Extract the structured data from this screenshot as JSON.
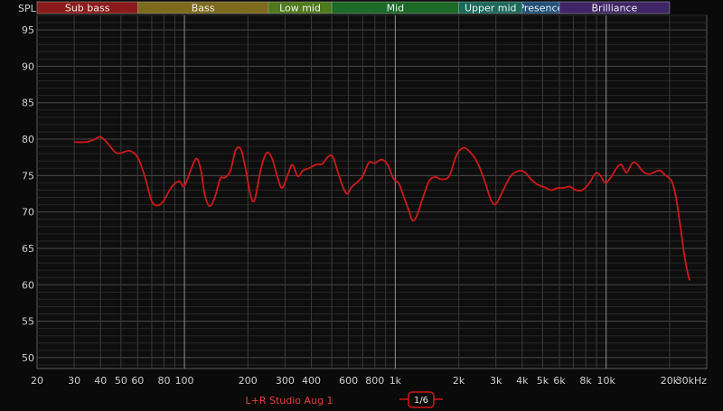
{
  "chart_data": {
    "type": "line",
    "ylabel": "SPL",
    "ylim": [
      48.5,
      97
    ],
    "xlim": [
      20,
      30000
    ],
    "x_scale": "log",
    "grid": true,
    "y_ticks": [
      95,
      90,
      85,
      80,
      75,
      70,
      65,
      60,
      55,
      50
    ],
    "x_ticks": [
      {
        "v": 20,
        "label": "20"
      },
      {
        "v": 30,
        "label": "30"
      },
      {
        "v": 40,
        "label": "40"
      },
      {
        "v": 50,
        "label": "50"
      },
      {
        "v": 60,
        "label": "60"
      },
      {
        "v": 80,
        "label": "80"
      },
      {
        "v": 100,
        "label": "100"
      },
      {
        "v": 200,
        "label": "200"
      },
      {
        "v": 300,
        "label": "300"
      },
      {
        "v": 400,
        "label": "400"
      },
      {
        "v": 600,
        "label": "600"
      },
      {
        "v": 800,
        "label": "800"
      },
      {
        "v": 1000,
        "label": "1k"
      },
      {
        "v": 2000,
        "label": "2k"
      },
      {
        "v": 3000,
        "label": "3k"
      },
      {
        "v": 4000,
        "label": "4k"
      },
      {
        "v": 5000,
        "label": "5k"
      },
      {
        "v": 6000,
        "label": "6k"
      },
      {
        "v": 8000,
        "label": "8k"
      },
      {
        "v": 10000,
        "label": "10k"
      },
      {
        "v": 20000,
        "label": "20k"
      },
      {
        "v": 30000,
        "label": "30kHz"
      }
    ],
    "bands": [
      {
        "name": "Sub bass",
        "from": 20,
        "to": 60,
        "color": "#8b1a1a"
      },
      {
        "name": "Bass",
        "from": 60,
        "to": 250,
        "color": "#7d6a1c"
      },
      {
        "name": "Low mid",
        "from": 250,
        "to": 500,
        "color": "#4f7a1c"
      },
      {
        "name": "Mid",
        "from": 500,
        "to": 2000,
        "color": "#1c6a28"
      },
      {
        "name": "Upper mid",
        "from": 2000,
        "to": 4000,
        "color": "#1a6a5a"
      },
      {
        "name": "Presence",
        "from": 4000,
        "to": 6000,
        "color": "#1f4f7a"
      },
      {
        "name": "Brilliance",
        "from": 6000,
        "to": 20000,
        "color": "#3f2566"
      }
    ],
    "series": [
      {
        "name": "L+R Studio Aug 1",
        "color": "#d01818",
        "points": [
          [
            30,
            79.6
          ],
          [
            34,
            79.6
          ],
          [
            37,
            79.9
          ],
          [
            40,
            80.3
          ],
          [
            43,
            79.5
          ],
          [
            47,
            78.2
          ],
          [
            50,
            78.1
          ],
          [
            55,
            78.4
          ],
          [
            60,
            77.5
          ],
          [
            65,
            74.8
          ],
          [
            70,
            71.5
          ],
          [
            75,
            70.9
          ],
          [
            80,
            71.6
          ],
          [
            85,
            73.0
          ],
          [
            90,
            73.9
          ],
          [
            95,
            74.2
          ],
          [
            100,
            73.6
          ],
          [
            110,
            76.6
          ],
          [
            115,
            77.3
          ],
          [
            120,
            75.6
          ],
          [
            125,
            72.3
          ],
          [
            132,
            70.8
          ],
          [
            140,
            72.2
          ],
          [
            148,
            74.6
          ],
          [
            155,
            74.7
          ],
          [
            165,
            75.6
          ],
          [
            175,
            78.5
          ],
          [
            185,
            78.6
          ],
          [
            195,
            76.0
          ],
          [
            205,
            72.5
          ],
          [
            215,
            71.6
          ],
          [
            230,
            75.8
          ],
          [
            245,
            78.1
          ],
          [
            260,
            77.4
          ],
          [
            275,
            75.0
          ],
          [
            290,
            73.3
          ],
          [
            310,
            75.2
          ],
          [
            325,
            76.5
          ],
          [
            345,
            74.9
          ],
          [
            365,
            75.7
          ],
          [
            390,
            76.0
          ],
          [
            420,
            76.5
          ],
          [
            450,
            76.6
          ],
          [
            480,
            77.6
          ],
          [
            505,
            77.6
          ],
          [
            530,
            75.8
          ],
          [
            560,
            73.7
          ],
          [
            590,
            72.5
          ],
          [
            620,
            73.4
          ],
          [
            660,
            74.1
          ],
          [
            700,
            74.9
          ],
          [
            750,
            76.8
          ],
          [
            800,
            76.7
          ],
          [
            860,
            77.2
          ],
          [
            920,
            76.5
          ],
          [
            980,
            74.6
          ],
          [
            1040,
            73.9
          ],
          [
            1100,
            72.0
          ],
          [
            1160,
            70.2
          ],
          [
            1210,
            68.8
          ],
          [
            1270,
            69.6
          ],
          [
            1350,
            71.9
          ],
          [
            1450,
            74.3
          ],
          [
            1550,
            74.8
          ],
          [
            1650,
            74.5
          ],
          [
            1800,
            74.9
          ],
          [
            1950,
            77.8
          ],
          [
            2100,
            78.8
          ],
          [
            2250,
            78.3
          ],
          [
            2450,
            76.8
          ],
          [
            2650,
            74.3
          ],
          [
            2850,
            71.6
          ],
          [
            3000,
            71.1
          ],
          [
            3200,
            72.6
          ],
          [
            3500,
            74.8
          ],
          [
            3800,
            75.6
          ],
          [
            4100,
            75.5
          ],
          [
            4400,
            74.5
          ],
          [
            4700,
            73.8
          ],
          [
            5100,
            73.4
          ],
          [
            5500,
            73.0
          ],
          [
            5900,
            73.3
          ],
          [
            6300,
            73.3
          ],
          [
            6700,
            73.5
          ],
          [
            7200,
            73.0
          ],
          [
            7700,
            73.0
          ],
          [
            8300,
            73.9
          ],
          [
            8900,
            75.3
          ],
          [
            9400,
            75.0
          ],
          [
            9900,
            74.0
          ],
          [
            10500,
            74.7
          ],
          [
            11200,
            76.0
          ],
          [
            11800,
            76.5
          ],
          [
            12500,
            75.4
          ],
          [
            13300,
            76.7
          ],
          [
            14000,
            76.6
          ],
          [
            15000,
            75.5
          ],
          [
            16000,
            75.2
          ],
          [
            17000,
            75.5
          ],
          [
            18000,
            75.7
          ],
          [
            19000,
            75.1
          ],
          [
            20500,
            74.2
          ],
          [
            21500,
            71.8
          ],
          [
            22500,
            68.0
          ],
          [
            23500,
            64.0
          ],
          [
            24500,
            61.3
          ],
          [
            25000,
            60.6
          ]
        ]
      }
    ],
    "smoothing_label": "1/6"
  },
  "colors": {
    "background": "#0a0a0a",
    "grid_minor": "#3a3a3a",
    "grid_major": "#8a8a8a",
    "trace": "#d01818"
  }
}
